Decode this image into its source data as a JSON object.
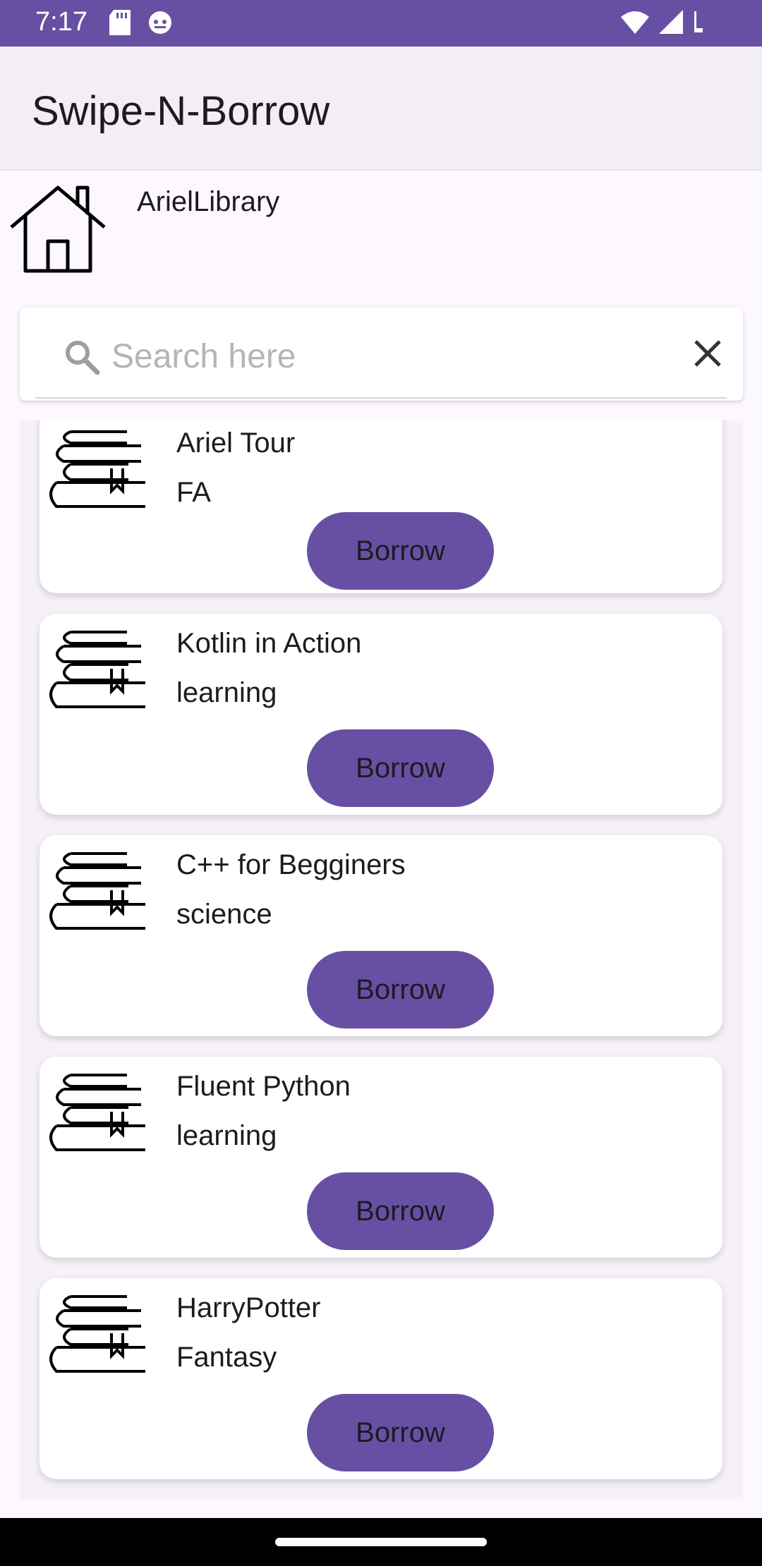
{
  "status_bar": {
    "time": "7:17",
    "color": "#6750a4"
  },
  "app_bar": {
    "title": "Swipe-N-Borrow"
  },
  "library": {
    "name": "ArielLibrary",
    "icon": "home-icon"
  },
  "search": {
    "placeholder": "Search here",
    "icon": "search-icon",
    "clear_icon": "close-icon"
  },
  "books": [
    {
      "title": "Ariel Tour",
      "category": "FA",
      "button_label": "Borrow"
    },
    {
      "title": "Kotlin in Action",
      "category": "learning",
      "button_label": "Borrow"
    },
    {
      "title": "C++ for Begginers",
      "category": "science",
      "button_label": "Borrow"
    },
    {
      "title": "Fluent Python",
      "category": "learning",
      "button_label": "Borrow"
    },
    {
      "title": "HarryPotter",
      "category": "Fantasy",
      "button_label": "Borrow"
    }
  ],
  "colors": {
    "accent": "#6750a4",
    "background": "#fdf7ff",
    "app_bar": "#f3eef6"
  }
}
